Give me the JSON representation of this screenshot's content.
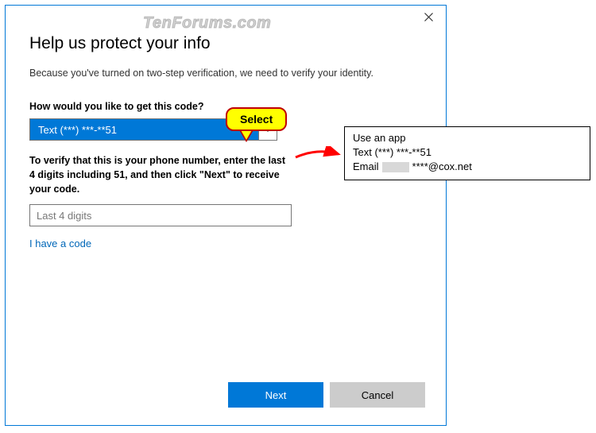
{
  "watermark": "TenForums.com",
  "dialog": {
    "heading": "Help us protect your info",
    "subtext": "Because you've turned on two-step verification, we need to verify your identity.",
    "prompt": "How would you like to get this code?",
    "select_value": "Text (***) ***-**51",
    "verify_text": "To verify that this is your phone number, enter the last 4 digits including 51, and then click \"Next\" to receive your code.",
    "input_placeholder": "Last 4 digits",
    "link": "I have a code",
    "next": "Next",
    "cancel": "Cancel"
  },
  "callout": "Select",
  "popup": {
    "opt1": "Use an app",
    "opt2": "Text (***) ***-**51",
    "opt3_prefix": "Email",
    "opt3_suffix": "****@cox.net"
  }
}
